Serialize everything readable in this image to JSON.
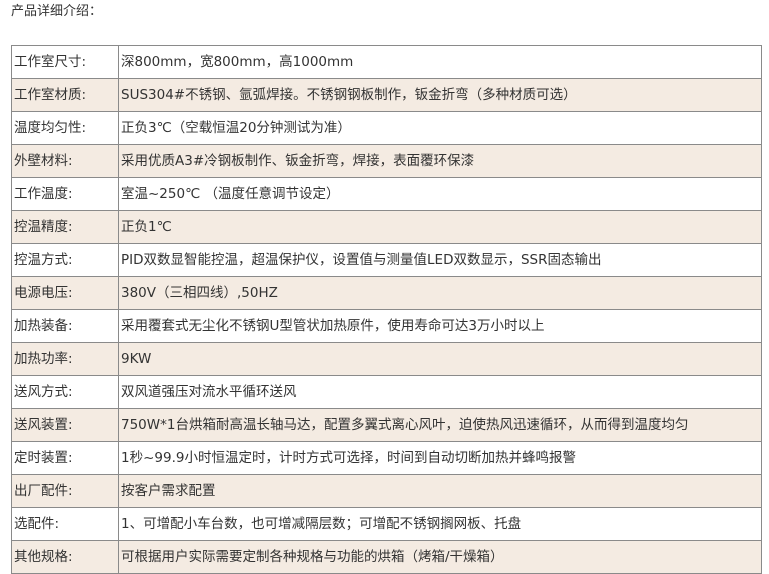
{
  "intro_title": "产品详细介绍：",
  "rows": [
    {
      "label": "工作室尺寸:",
      "value": "深800mm，宽800mm，高1000mm"
    },
    {
      "label": "工作室材质:",
      "value": "SUS304#不锈钢、氩弧焊接。不锈钢钢板制作，钣金折弯（多种材质可选）"
    },
    {
      "label": "温度均匀性:",
      "value": " 正负3℃（空载恒温20分钟测试为准）"
    },
    {
      "label": "外壁材料:",
      "value": "采用优质A3#冷钢板制作、钣金折弯，焊接，表面覆环保漆"
    },
    {
      "label": "工作温度:",
      "value": "室温~250℃ （温度任意调节设定）"
    },
    {
      "label": "控温精度:",
      "value": "正负1℃"
    },
    {
      "label": "控温方式:",
      "value": "PID双数显智能控温，超温保护仪，设置值与测量值LED双数显示，SSR固态输出"
    },
    {
      "label": "电源电压:",
      "value": "380V（三相四线）,50HZ"
    },
    {
      "label": "加热装备:",
      "value": "采用覆套式无尘化不锈钢U型管状加热原件，使用寿命可达3万小时以上"
    },
    {
      "label": "加热功率:",
      "value": "9KW"
    },
    {
      "label": "送风方式:",
      "value": "双风道强压对流水平循环送风"
    },
    {
      "label": "送风装置:",
      "value": "750W*1台烘箱耐高温长轴马达，配置多翼式离心风叶，迫使热风迅速循环，从而得到温度均匀"
    },
    {
      "label": "定时装置:",
      "value": " 1秒~99.9小时恒温定时，计时方式可选择，时间到自动切断加热并蜂鸣报警"
    },
    {
      "label": "出厂配件:",
      "value": "按客户需求配置"
    },
    {
      "label": "选配件:",
      "value": "1、可增配小车台数，也可增减隔层数；可增配不锈钢搁网板、托盘"
    },
    {
      "label": "其他规格:",
      "value": "可根据用户实际需要定制各种规格与功能的烘箱（烤箱/干燥箱）"
    }
  ],
  "colors": {
    "row_tint": "#f4ebe2",
    "border": "#8a8a8a",
    "text": "#333333"
  }
}
